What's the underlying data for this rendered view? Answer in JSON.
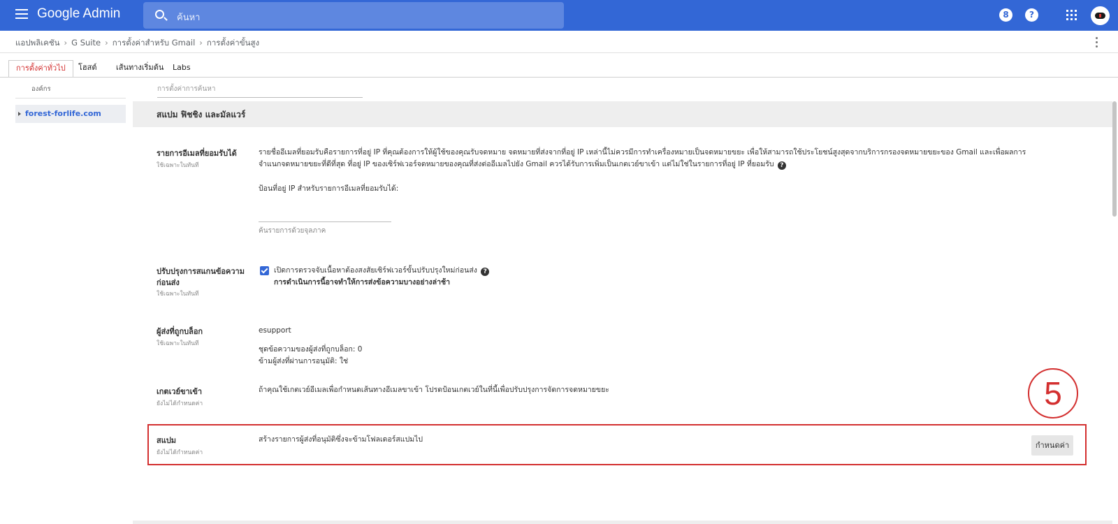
{
  "app": {
    "brand": "Google Admin",
    "search_placeholder": "ค้นหา"
  },
  "topbar_icons": [
    "support-icon",
    "help-icon",
    "apps-grid-icon",
    "account-avatar"
  ],
  "topbar_icon_glyphs": {
    "support": "8",
    "help": "?"
  },
  "breadcrumb": [
    "แอปพลิเคชัน",
    "G Suite",
    "การตั้งค่าสำหรับ Gmail",
    "การตั้งค่าขั้นสูง"
  ],
  "breadcrumb_sep": "›",
  "tabs": [
    {
      "label": "การตั้งค่าทั่วไป",
      "active": true
    },
    {
      "label": "โฮสต์",
      "active": false
    },
    {
      "label": "เส้นทางเริ่มต้น",
      "active": false
    },
    {
      "label": "Labs",
      "active": false
    }
  ],
  "org": {
    "label": "องค์กร",
    "item": "forest-forlife.com"
  },
  "settings_search_placeholder": "การตั้งค่าการค้นหา",
  "section": {
    "title": "สแปม ฟิชชิง และมัลแวร์"
  },
  "rows": {
    "approved": {
      "title": "รายการอีเมลที่ยอมรับได้",
      "sub": "ใช้เฉพาะในทันที",
      "desc1": "รายชื่ออีเมลที่ยอมรับคือรายการที่อยู่ IP ที่คุณต้องการให้ผู้ใช้ของคุณรับจดหมาย จดหมายที่ส่งจากที่อยู่ IP เหล่านี้ไม่ควรมีการทำเครื่องหมายเป็นจดหมายขยะ เพื่อให้สามารถใช้ประโยชน์สูงสุดจากบริการกรองจดหมายขยะของ Gmail และเพื่อผลการ",
      "desc2": "จำแนกจดหมายขยะที่ดีที่สุด ที่อยู่ IP ของเซิร์ฟเวอร์จดหมายของคุณที่ส่งต่ออีเมลไปยัง Gmail ควรได้รับการเพิ่มเป็นเกตเวย์ขาเข้า แต่ไม่ใช่ในรายการที่อยู่ IP ที่ยอมรับ",
      "input_label": "ป้อนที่อยู่ IP สำหรับรายการอีเมลที่ยอมรับได้:",
      "filter_link": "ค้นรายการด้วยจุลภาค"
    },
    "prescan": {
      "title": "ปรับปรุงการสแกนข้อความก่อนส่ง",
      "sub": "ใช้เฉพาะในทันที",
      "checkbox_label": "เปิดการตรวจจับเนื้อหาต้องสงสัยเซิร์ฟเวอร์ขั้นปรับปรุงใหม่ก่อนส่ง",
      "note": "การดำเนินการนี้อาจทำให้การส่งข้อความบางอย่างล่าช้า",
      "checked": true
    },
    "blocked": {
      "title": "ผู้ส่งที่ถูกบล็อก",
      "sub": "ใช้เฉพาะในทันที",
      "name": "esupport",
      "count_line": "ชุดข้อความของผู้ส่งที่ถูกบล็อก:  0",
      "bypass_line": "ข้ามผู้ส่งที่ผ่านการอนุมัติ:  ใช่"
    },
    "gateway": {
      "title": "เกตเวย์ขาเข้า",
      "sub": "ยังไม่ได้กำหนดค่า",
      "desc": "ถ้าคุณใช้เกตเวย์อีเมลเพื่อกำหนดเส้นทางอีเมลขาเข้า โปรดป้อนเกตเวย์ในที่นี้เพื่อปรับปรุงการจัดการจดหมายขยะ"
    },
    "spam": {
      "title": "สแปม",
      "sub": "ยังไม่ได้กำหนดค่า",
      "desc": "สร้างรายการผู้ส่งที่อนุมัติซึ่งจะข้ามโฟลเดอร์สแปมไป",
      "button": "กำหนดค่า"
    }
  },
  "annotation": {
    "step": "5",
    "color": "#d32f2f"
  },
  "colors": {
    "topbar": "#3367d6",
    "accent": "#d32f2f"
  }
}
